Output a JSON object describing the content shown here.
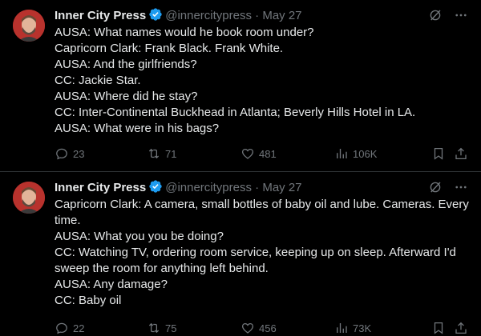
{
  "tweets": [
    {
      "author_name": "Inner City Press",
      "handle": "@innercitypress",
      "separator": "·",
      "date": "May 27",
      "lines": [
        "AUSA: What names would he book room under?",
        "Capricorn Clark: Frank Black. Frank White.",
        "AUSA: And the girlfriends?",
        "CC: Jackie Star.",
        "AUSA: Where did he stay?",
        "CC: Inter-Continental Buckhead in Atlanta; Beverly Hills Hotel in LA.",
        "AUSA: What were in his bags?"
      ],
      "replies": "23",
      "reposts": "71",
      "likes": "481",
      "views": "106K"
    },
    {
      "author_name": "Inner City Press",
      "handle": "@innercitypress",
      "separator": "·",
      "date": "May 27",
      "lines": [
        "Capricorn Clark: A camera, small bottles of baby oil and lube. Cameras. Every time.",
        "AUSA: What you you be doing?",
        "CC: Watching TV, ordering room service, keeping up on sleep. Afterward I'd sweep the room for anything left behind.",
        "AUSA: Any damage?",
        "CC: Baby oil"
      ],
      "replies": "22",
      "reposts": "75",
      "likes": "456",
      "views": "73K"
    }
  ],
  "colors": {
    "background": "#000000",
    "text": "#e7e9ea",
    "muted": "#71767b",
    "verified": "#1d9bf0",
    "divider": "#2f3336"
  },
  "icons": [
    "grok-icon",
    "more-icon",
    "reply-icon",
    "repost-icon",
    "like-icon",
    "views-icon",
    "bookmark-icon",
    "share-icon",
    "verified-badge-icon"
  ]
}
